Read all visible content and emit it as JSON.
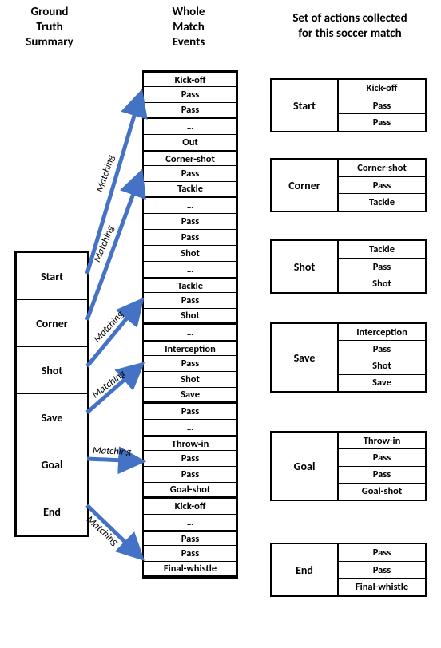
{
  "headers": {
    "left": "Ground\nTruth\nSummary",
    "mid": "Whole\nMatch\nEvents",
    "right": "Set of actions collected\nfor this soccer match"
  },
  "summary": [
    "Start",
    "Corner",
    "Shot",
    "Save",
    "Goal",
    "End"
  ],
  "events": [
    {
      "t": "Kick-off",
      "bt": true
    },
    {
      "t": "Pass"
    },
    {
      "t": "Pass",
      "bb": true
    },
    {
      "t": "…"
    },
    {
      "t": "Out"
    },
    {
      "t": "Corner-shot",
      "bt": true
    },
    {
      "t": "Pass"
    },
    {
      "t": "Tackle",
      "bb": true
    },
    {
      "t": "…"
    },
    {
      "t": "Pass"
    },
    {
      "t": "Pass"
    },
    {
      "t": "Shot"
    },
    {
      "t": "…"
    },
    {
      "t": "Tackle",
      "bt": true
    },
    {
      "t": "Pass"
    },
    {
      "t": "Shot",
      "bb": true
    },
    {
      "t": "…"
    },
    {
      "t": "Interception",
      "bt": true
    },
    {
      "t": "Pass"
    },
    {
      "t": "Shot"
    },
    {
      "t": "Save",
      "bb": true
    },
    {
      "t": "Pass"
    },
    {
      "t": "…"
    },
    {
      "t": "Throw-in",
      "bt": true
    },
    {
      "t": "Pass"
    },
    {
      "t": "Pass"
    },
    {
      "t": "Goal-shot",
      "bb": true
    },
    {
      "t": "Kick-off"
    },
    {
      "t": "…"
    },
    {
      "t": "Pass",
      "bt": true
    },
    {
      "t": "Pass"
    },
    {
      "t": "Final-whistle",
      "bb": true
    }
  ],
  "collected": [
    {
      "name": "Start",
      "rows": [
        "Kick-off",
        "Pass",
        "Pass"
      ]
    },
    {
      "name": "Corner",
      "rows": [
        "Corner-shot",
        "Pass",
        "Tackle"
      ]
    },
    {
      "name": "Shot",
      "rows": [
        "Tackle",
        "Pass",
        "Shot"
      ]
    },
    {
      "name": "Save",
      "rows": [
        "Interception",
        "Pass",
        "Shot",
        "Save"
      ]
    },
    {
      "name": "Goal",
      "rows": [
        "Throw-in",
        "Pass",
        "Pass",
        "Goal-shot"
      ]
    },
    {
      "name": "End",
      "rows": [
        "Pass",
        "Pass",
        "Final-whistle"
      ]
    }
  ],
  "matching_label": "Matching"
}
